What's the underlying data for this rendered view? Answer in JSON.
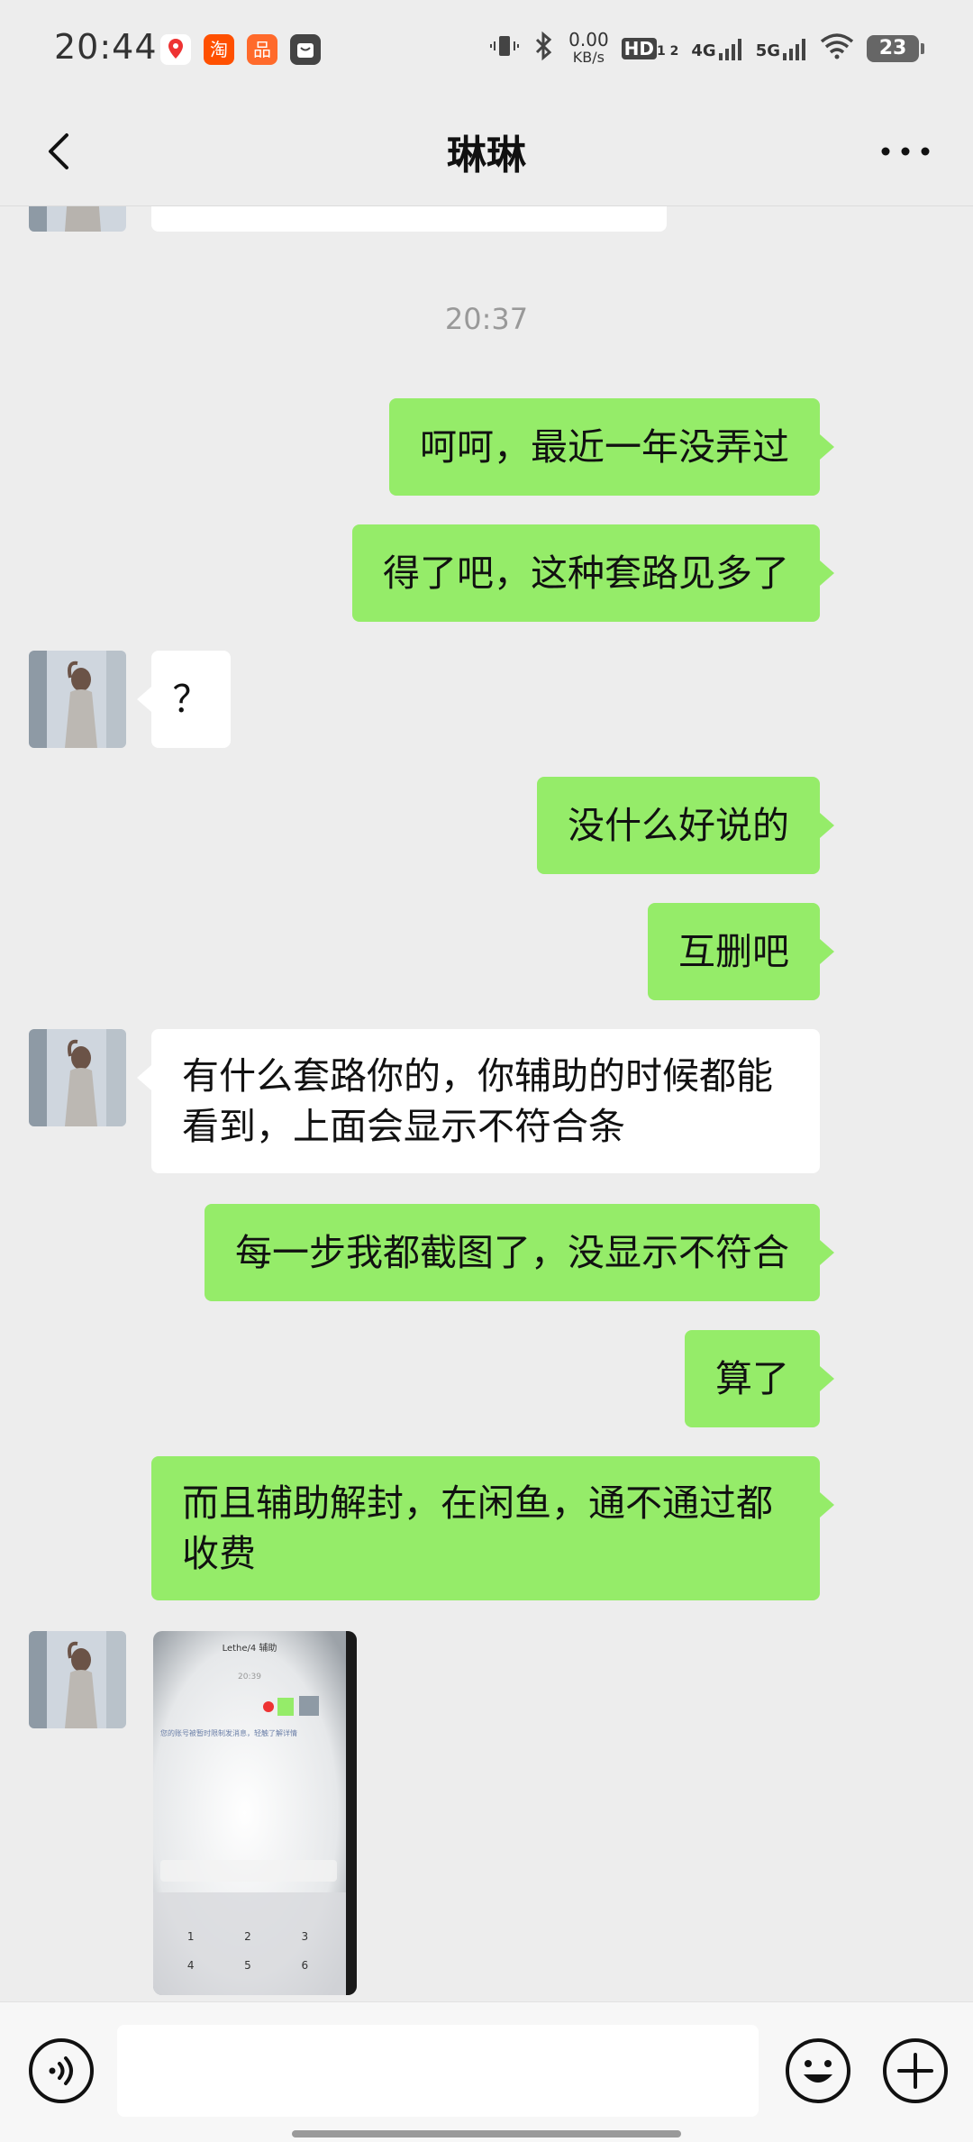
{
  "status_bar": {
    "time": "20:44",
    "net_speed_value": "0.00",
    "net_speed_unit": "KB/s",
    "hd_label": "HD",
    "hd_sub": "1 2",
    "network_4g": "4G",
    "network_5g": "5G",
    "battery": "23",
    "app_icons": [
      "map-pin-app-icon",
      "taobao-app-icon",
      "shopping-app-icon",
      "bag-app-icon"
    ]
  },
  "header": {
    "title": "琳琳"
  },
  "chat": {
    "timestamp": "20:37",
    "messages": [
      {
        "from": "me",
        "text": "呵呵，最近一年没弄过"
      },
      {
        "from": "me",
        "text": "得了吧，这种套路见多了"
      },
      {
        "from": "other",
        "text": "？"
      },
      {
        "from": "me",
        "text": "没什么好说的"
      },
      {
        "from": "me",
        "text": "互删吧"
      },
      {
        "from": "other",
        "text": "有什么套路你的，你辅助的时候都能看到，上面会显示不符合条"
      },
      {
        "from": "me",
        "text": "每一步我都截图了，没显示不符合"
      },
      {
        "from": "me",
        "text": "算了"
      },
      {
        "from": "me",
        "text": "而且辅助解封，在闲鱼，通不通过都收费"
      },
      {
        "from": "other",
        "type": "image"
      }
    ]
  },
  "screenshot_thumb": {
    "title": "Lethe/4 辅助",
    "time": "20:39",
    "notice": "您的账号被暂时限制发消息，轻触了解详情",
    "keys": [
      "1",
      "2",
      "3",
      "4",
      "5",
      "6"
    ]
  },
  "input_bar": {
    "value": "",
    "placeholder": ""
  },
  "colors": {
    "background": "#ededed",
    "my_bubble": "#95ec69",
    "other_bubble": "#ffffff"
  }
}
